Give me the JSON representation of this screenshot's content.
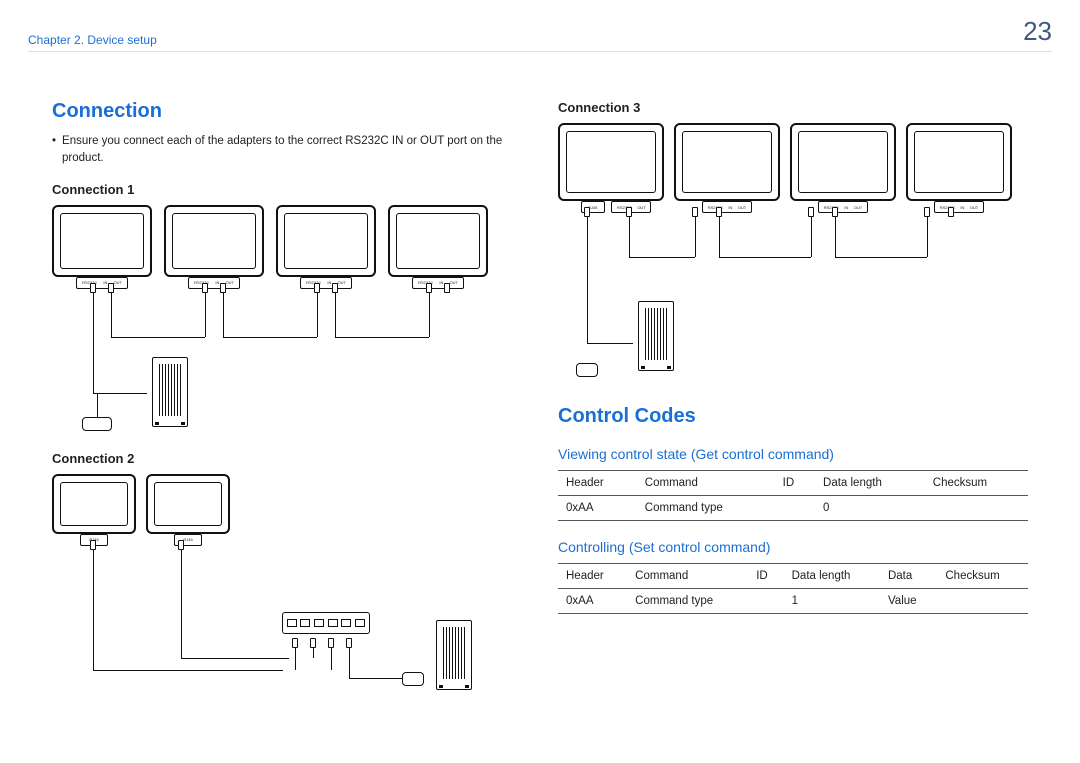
{
  "header": {
    "chapter": "Chapter 2. Device setup",
    "page": "23"
  },
  "left": {
    "h2": "Connection",
    "bullet": "Ensure you connect each of the adapters to the correct RS232C IN or OUT port on the product.",
    "conn1": "Connection 1",
    "conn2": "Connection 2",
    "port_label_rs232c": "RS232C",
    "port_in": "IN",
    "port_out": "OUT",
    "port_rj45": "RJ45"
  },
  "right": {
    "conn3": "Connection 3",
    "h2": "Control Codes",
    "sub1": "Viewing control state (Get control command)",
    "sub2": "Controlling (Set control command)",
    "port_rj45": "RJ45",
    "port_rs232c": "RS232C",
    "port_in": "IN",
    "port_out": "OUT"
  },
  "table_get": {
    "headers": [
      "Header",
      "Command",
      "ID",
      "Data length",
      "Checksum"
    ],
    "row": [
      "0xAA",
      "Command type",
      "",
      "0",
      ""
    ]
  },
  "table_set": {
    "headers": [
      "Header",
      "Command",
      "ID",
      "Data length",
      "Data",
      "Checksum"
    ],
    "row": [
      "0xAA",
      "Command type",
      "",
      "1",
      "Value",
      ""
    ]
  }
}
